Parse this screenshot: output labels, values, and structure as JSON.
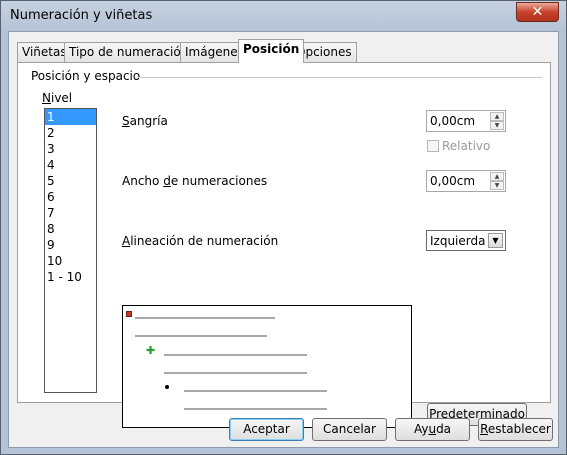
{
  "window": {
    "title": "Numeración y viñetas",
    "close_glyph": "✕"
  },
  "tabs": [
    {
      "label": "Viñetas",
      "active": false
    },
    {
      "label": "Tipo de numeración",
      "active": false
    },
    {
      "label": "Imágenes",
      "active": false
    },
    {
      "label": "Posición",
      "active": true
    },
    {
      "label": "Opciones",
      "active": false
    }
  ],
  "position": {
    "section_title": "Posición y espacio",
    "nivel": {
      "label_accel": "N",
      "label_rest": "ivel"
    },
    "levels": [
      "1",
      "2",
      "3",
      "4",
      "5",
      "6",
      "7",
      "8",
      "9",
      "10",
      "1 - 10"
    ],
    "selected_level": "1",
    "sangria": {
      "label_accel": "S",
      "label_rest": "angría",
      "value": "0,00cm"
    },
    "relativo": {
      "label": "Relativo",
      "checked": false,
      "enabled": false
    },
    "ancho": {
      "label_before": "Ancho ",
      "label_accel": "d",
      "label_after": "e numeraciones",
      "value": "0,00cm"
    },
    "alineacion": {
      "label_accel": "A",
      "label_rest": "lineación de numeración",
      "value": "Izquierda"
    },
    "default_button": {
      "label_accel": "P",
      "label_rest": "redeterminado"
    }
  },
  "footer": {
    "aceptar": "Aceptar",
    "cancelar": "Cancelar",
    "ayuda": {
      "label_before": "Ay",
      "label_accel": "u",
      "label_after": "da"
    },
    "restablecer": {
      "label_accel": "R",
      "label_rest": "establecer"
    }
  },
  "colors": {
    "selection": "#3399ff",
    "preview_level1_bullet": "#c0392b",
    "preview_level2_bullet": "#2a9d2a"
  },
  "icons": {
    "spin_up": "▲",
    "spin_down": "▼",
    "dropdown": "▼",
    "preview_bullet2": "✚"
  }
}
